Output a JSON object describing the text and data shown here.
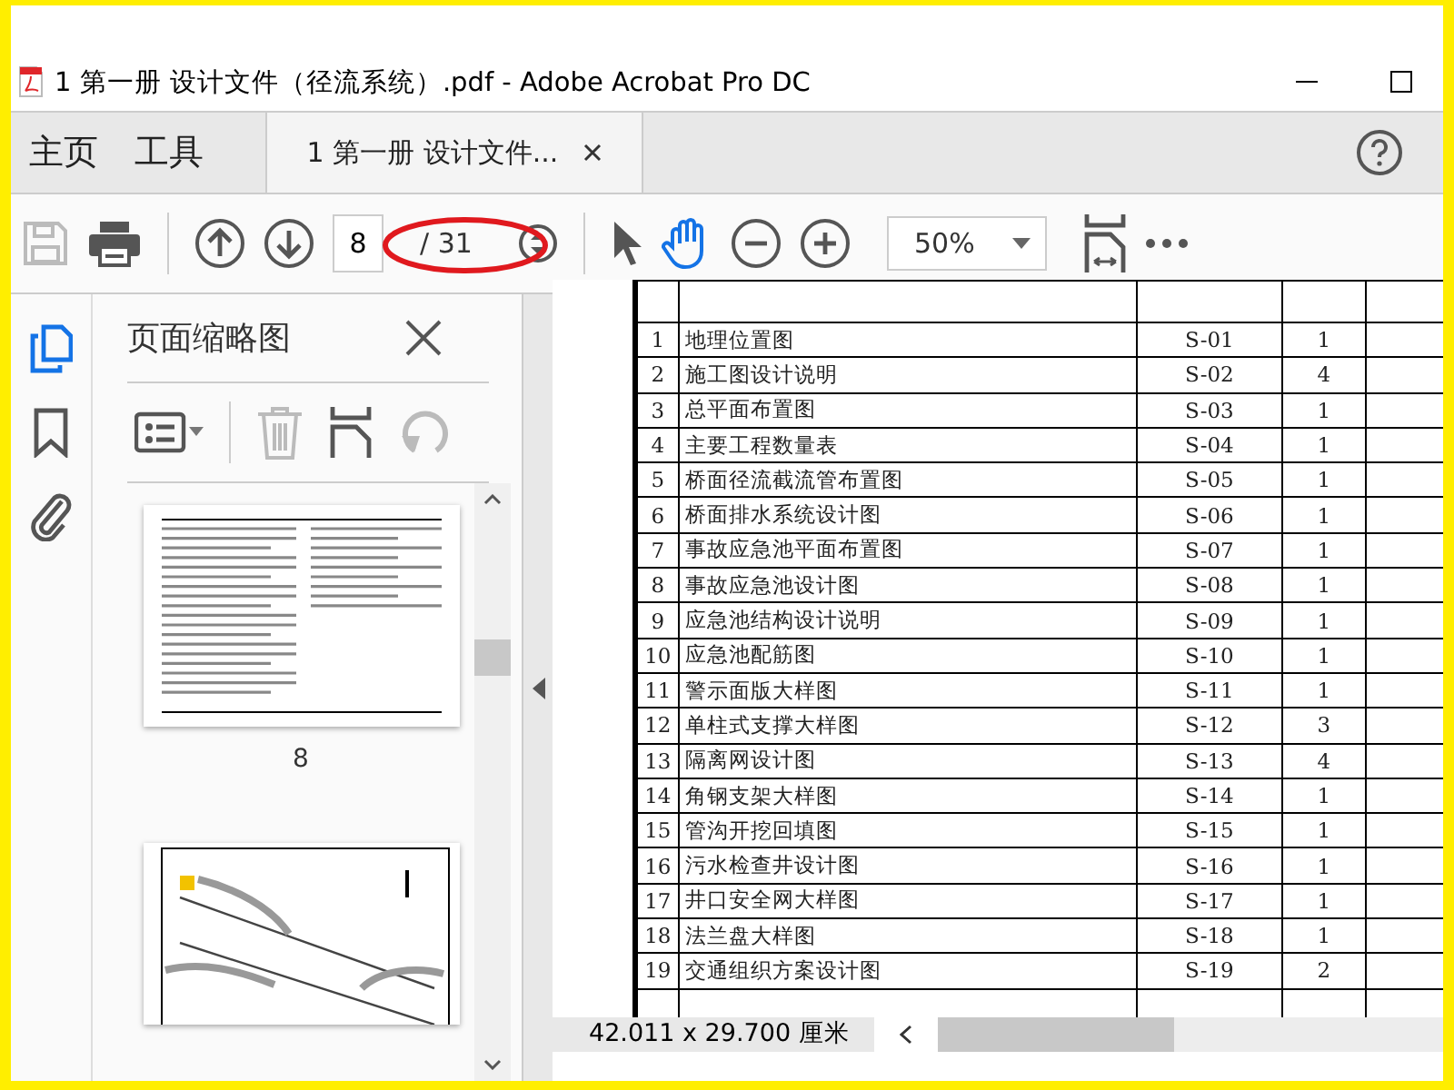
{
  "window": {
    "title": "1 第一册 设计文件（径流系统）.pdf - Adobe Acrobat Pro DC"
  },
  "nav_tabs": [
    {
      "label": "主页",
      "selected": false
    },
    {
      "label": "工具",
      "selected": false
    }
  ],
  "document_tab": {
    "label": "1 第一册 设计文件...",
    "selected": true
  },
  "toolbar": {
    "page_value": "8",
    "page_total": "/ 31",
    "zoom": "50%",
    "hand_tool_selected": true
  },
  "sidebar": {
    "title": "页面缩略图",
    "thumbnails": [
      {
        "label": "8",
        "kind": "text"
      },
      {
        "kind": "map"
      }
    ]
  },
  "table": {
    "rows": [
      {
        "no": "1",
        "name": "地理位置图",
        "code": "S-01",
        "count": "1"
      },
      {
        "no": "2",
        "name": "施工图设计说明",
        "code": "S-02",
        "count": "4"
      },
      {
        "no": "3",
        "name": "总平面布置图",
        "code": "S-03",
        "count": "1"
      },
      {
        "no": "4",
        "name": "主要工程数量表",
        "code": "S-04",
        "count": "1"
      },
      {
        "no": "5",
        "name": "桥面径流截流管布置图",
        "code": "S-05",
        "count": "1"
      },
      {
        "no": "6",
        "name": "桥面排水系统设计图",
        "code": "S-06",
        "count": "1"
      },
      {
        "no": "7",
        "name": "事故应急池平面布置图",
        "code": "S-07",
        "count": "1"
      },
      {
        "no": "8",
        "name": "事故应急池设计图",
        "code": "S-08",
        "count": "1"
      },
      {
        "no": "9",
        "name": "应急池结构设计说明",
        "code": "S-09",
        "count": "1"
      },
      {
        "no": "10",
        "name": "应急池配筋图",
        "code": "S-10",
        "count": "1"
      },
      {
        "no": "11",
        "name": "警示面版大样图",
        "code": "S-11",
        "count": "1"
      },
      {
        "no": "12",
        "name": "单柱式支撑大样图",
        "code": "S-12",
        "count": "3"
      },
      {
        "no": "13",
        "name": "隔离网设计图",
        "code": "S-13",
        "count": "4"
      },
      {
        "no": "14",
        "name": "角钢支架大样图",
        "code": "S-14",
        "count": "1"
      },
      {
        "no": "15",
        "name": "管沟开挖回填图",
        "code": "S-15",
        "count": "1"
      },
      {
        "no": "16",
        "name": "污水检查井设计图",
        "code": "S-16",
        "count": "1"
      },
      {
        "no": "17",
        "name": "井口安全网大样图",
        "code": "S-17",
        "count": "1"
      },
      {
        "no": "18",
        "name": "法兰盘大样图",
        "code": "S-18",
        "count": "1"
      },
      {
        "no": "19",
        "name": "交通组织方案设计图",
        "code": "S-19",
        "count": "2"
      }
    ]
  },
  "status_bar": {
    "page_size": "42.011 x 29.700 厘米"
  }
}
